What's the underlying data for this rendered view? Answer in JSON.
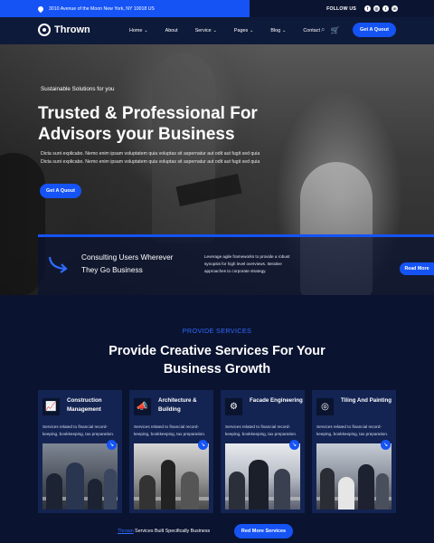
{
  "topbar": {
    "address": "3010 Avenue of the Moon New York, NY 10018 US",
    "follow_label": "FOLLOW US",
    "socials": [
      {
        "icon": "facebook-icon",
        "glyph": "f"
      },
      {
        "icon": "instagram-icon",
        "glyph": "◎"
      },
      {
        "icon": "twitter-icon",
        "glyph": "t"
      },
      {
        "icon": "linkedin-icon",
        "glyph": "in"
      }
    ]
  },
  "header": {
    "brand": "Thrown",
    "nav": [
      {
        "label": "Home",
        "has_dropdown": true
      },
      {
        "label": "About",
        "has_dropdown": false
      },
      {
        "label": "Service",
        "has_dropdown": true
      },
      {
        "label": "Pages",
        "has_dropdown": true
      },
      {
        "label": "Blog",
        "has_dropdown": true
      },
      {
        "label": "Contact",
        "has_dropdown": false
      }
    ],
    "quote_button": "Get A Quout"
  },
  "hero": {
    "subtitle": "Sustainable Solutions for you",
    "title": "Trusted & Professional For Advisors your Business",
    "description": "Dicta sunt explicabo. Nemo enim ipsam voluptatem quia voluptas sit aspernatur aut odit aut fugit sed quia Dicta sunt explicabo. Nemo enim ipsam voluptatem quia voluptas sit aspernatur aut odit aut fugit sed quia",
    "quote_button": "Get A Quout",
    "strip": {
      "title": "Consulting Users Wherever They Go Business",
      "text": "Leverage agile frameworks to provide a robust synopsis for high level overviews. Iterative approaches to corporate strategy.",
      "button": "Read More"
    }
  },
  "services": {
    "eyebrow": "PROVIDE SERVICES",
    "title": "Provide Creative Services For Your Business Growth",
    "cards": [
      {
        "title": "Construction Management",
        "text": "Services related to financial record-keeping, bookkeeping, tax preparation.",
        "icon": "chart-growth-icon",
        "glyph": "📈"
      },
      {
        "title": "Architecture & Building",
        "text": "Services related to financial record-keeping, bookkeeping, tax preparation.",
        "icon": "megaphone-icon",
        "glyph": "📣"
      },
      {
        "title": "Facade Engineering",
        "text": "Services related to financial record-keeping, bookkeeping, tax preparation.",
        "icon": "gear-icon",
        "glyph": "⚙"
      },
      {
        "title": "Tiling And Painting",
        "text": "Services related to financial record-keeping, bookkeeping, tax preparation.",
        "icon": "target-icon",
        "glyph": "◎"
      }
    ],
    "footer_brand": "Thrown",
    "footer_text": "Services Built Specifically Business",
    "footer_button": "Red More Services"
  },
  "colors": {
    "accent": "#1553f5",
    "navy": "#0a1330",
    "card": "#132352"
  }
}
